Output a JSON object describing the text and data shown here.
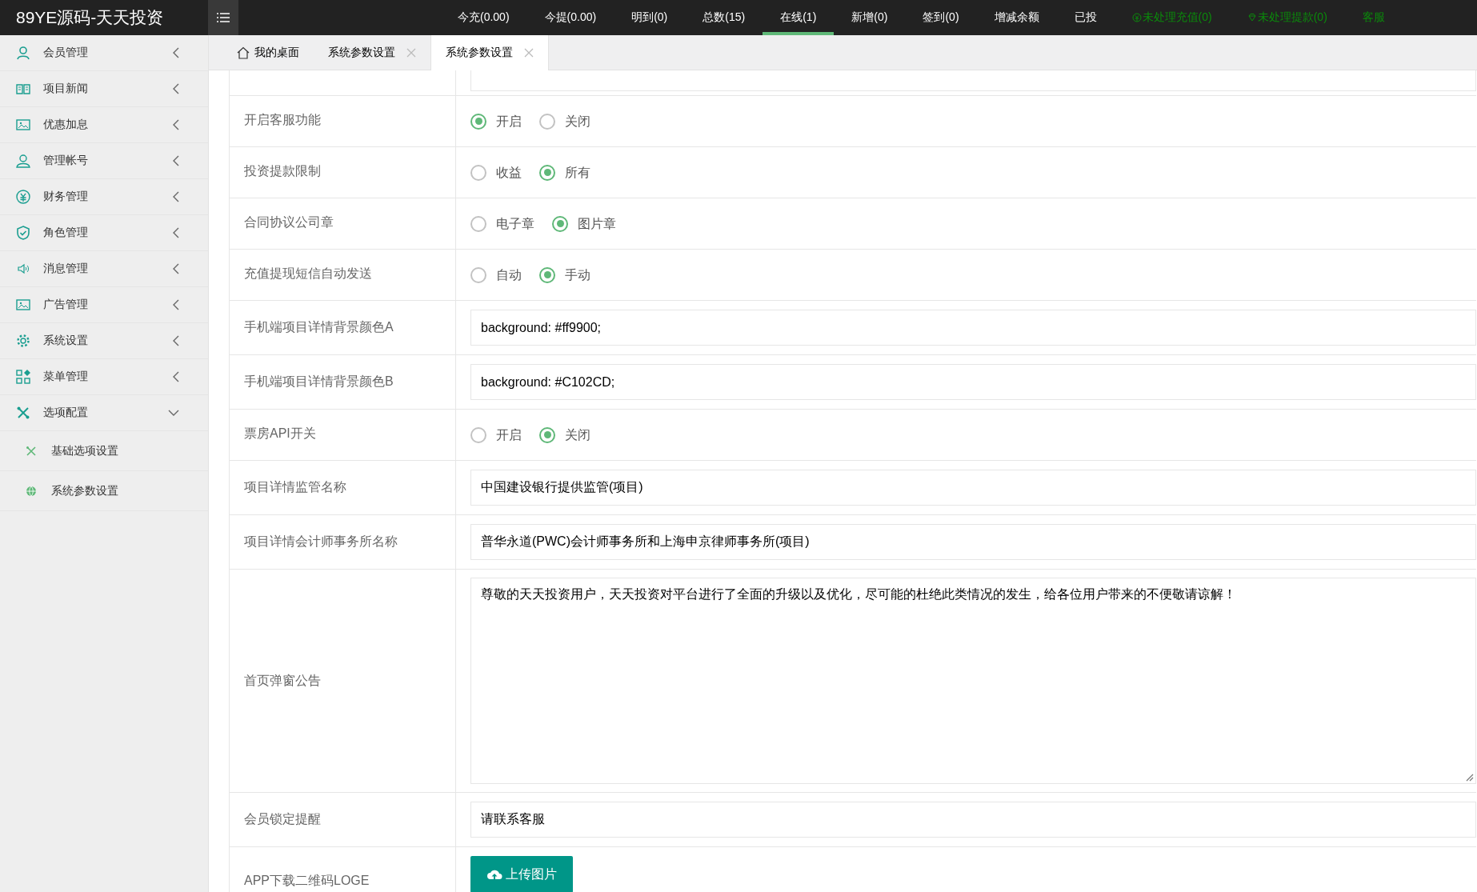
{
  "header": {
    "logo": "89YE源码-天天投资",
    "nav": [
      {
        "label": "今充(0.00)",
        "kind": "plain",
        "selected": false
      },
      {
        "label": "今提(0.00)",
        "kind": "plain",
        "selected": false
      },
      {
        "label": "明到(0)",
        "kind": "plain",
        "selected": false
      },
      {
        "label": "总数(15)",
        "kind": "plain",
        "selected": false
      },
      {
        "label": "在线(1)",
        "kind": "plain",
        "selected": true
      },
      {
        "label": "新增(0)",
        "kind": "plain",
        "selected": false
      },
      {
        "label": "签到(0)",
        "kind": "plain",
        "selected": false
      },
      {
        "label": "增减余额",
        "kind": "plain",
        "selected": false
      },
      {
        "label": "已投",
        "kind": "plain",
        "selected": false
      },
      {
        "label": "未处理充值(0)",
        "kind": "alert",
        "selected": false
      },
      {
        "label": "未处理提款(0)",
        "kind": "alert",
        "selected": false
      },
      {
        "label": "客服",
        "kind": "alert",
        "selected": false
      }
    ]
  },
  "sidebar": {
    "items": [
      {
        "label": "会员管理",
        "expanded": false
      },
      {
        "label": "项目新闻",
        "expanded": false
      },
      {
        "label": "优惠加息",
        "expanded": false
      },
      {
        "label": "管理帐号",
        "expanded": false
      },
      {
        "label": "财务管理",
        "expanded": false
      },
      {
        "label": "角色管理",
        "expanded": false
      },
      {
        "label": "消息管理",
        "expanded": false
      },
      {
        "label": "广告管理",
        "expanded": false
      },
      {
        "label": "系统设置",
        "expanded": false
      },
      {
        "label": "菜单管理",
        "expanded": false
      },
      {
        "label": "选项配置",
        "expanded": true,
        "children": [
          {
            "label": "基础选项设置"
          },
          {
            "label": "系统参数设置"
          }
        ]
      }
    ]
  },
  "tabs": [
    {
      "label": "我的桌面",
      "closable": false,
      "selected": false
    },
    {
      "label": "系统参数设置",
      "closable": true,
      "selected": false
    },
    {
      "label": "系统参数设置",
      "closable": true,
      "selected": true
    }
  ],
  "form": {
    "rows": [
      {
        "kind": "partial"
      },
      {
        "kind": "radio",
        "label": "开启客服功能",
        "options": [
          {
            "label": "开启",
            "selected": true
          },
          {
            "label": "关闭",
            "selected": false
          }
        ]
      },
      {
        "kind": "radio",
        "label": "投资提款限制",
        "options": [
          {
            "label": "收益",
            "selected": false
          },
          {
            "label": "所有",
            "selected": true
          }
        ]
      },
      {
        "kind": "radio",
        "label": "合同协议公司章",
        "options": [
          {
            "label": "电子章",
            "selected": false
          },
          {
            "label": "图片章",
            "selected": true
          }
        ]
      },
      {
        "kind": "radio",
        "label": "充值提现短信自动发送",
        "options": [
          {
            "label": "自动",
            "selected": false
          },
          {
            "label": "手动",
            "selected": true
          }
        ]
      },
      {
        "kind": "input",
        "label": "手机端项目详情背景颜色A",
        "value": "background: #ff9900;"
      },
      {
        "kind": "input",
        "label": "手机端项目详情背景颜色B",
        "value": "background: #C102CD;"
      },
      {
        "kind": "radio",
        "label": "票房API开关",
        "options": [
          {
            "label": "开启",
            "selected": false
          },
          {
            "label": "关闭",
            "selected": true
          }
        ]
      },
      {
        "kind": "input",
        "label": "项目详情监管名称",
        "value": "中国建设银行提供监管(项目)"
      },
      {
        "kind": "input",
        "label": "项目详情会计师事务所名称",
        "value": "普华永道(PWC)会计师事务所和上海申京律师事务所(项目)"
      },
      {
        "kind": "textarea",
        "label": "首页弹窗公告",
        "value": "尊敬的天天投资用户，天天投资对平台进行了全面的升级以及优化，尽可能的杜绝此类情况的发生，给各位用户带来的不便敬请谅解！"
      },
      {
        "kind": "input",
        "label": "会员锁定提醒",
        "value": "请联系客服"
      },
      {
        "kind": "upload",
        "label": "APP下载二维码LOGE",
        "button": "上传图片"
      }
    ]
  }
}
